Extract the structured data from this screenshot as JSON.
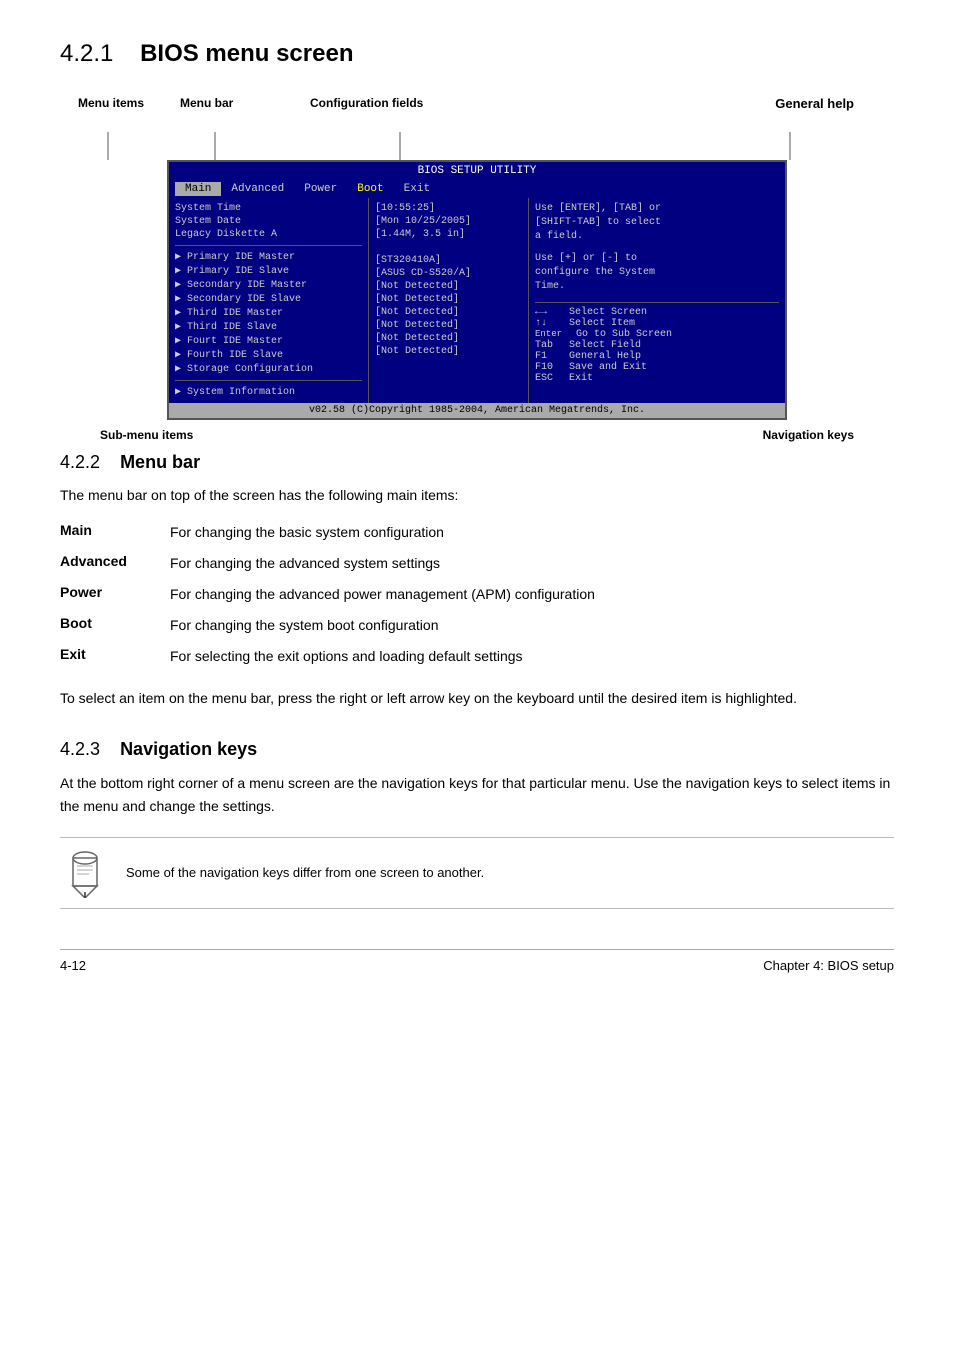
{
  "page": {
    "section_number": "4.2.1",
    "section_title": "BIOS menu screen",
    "subsections": [
      {
        "number": "4.2.2",
        "title": "Menu bar",
        "intro": "The menu bar on top of the screen has the following main items:",
        "menu_items": [
          {
            "key": "Main",
            "description": "For changing the basic system configuration"
          },
          {
            "key": "Advanced",
            "description": "For changing the advanced system settings"
          },
          {
            "key": "Power",
            "description": "For changing the advanced power management (APM) configuration"
          },
          {
            "key": "Boot",
            "description": "For changing the system boot configuration"
          },
          {
            "key": "Exit",
            "description": "For selecting the exit options and loading default settings"
          }
        ],
        "footer_text": "To select an item on the menu bar, press the right or left arrow key on the keyboard until the desired item is highlighted."
      },
      {
        "number": "4.2.3",
        "title": "Navigation keys",
        "intro": "At the bottom right corner of a menu screen are the navigation keys for that particular menu. Use the navigation keys to select items in the menu and change the settings.",
        "note": "Some of the navigation keys differ from one screen to another."
      }
    ]
  },
  "diagram": {
    "labels": {
      "menu_items": "Menu items",
      "menu_bar": "Menu bar",
      "config_fields": "Configuration fields",
      "general_help": "General help",
      "sub_menu_items": "Sub-menu items",
      "navigation_keys": "Navigation keys"
    },
    "bios": {
      "title": "BIOS SETUP UTILITY",
      "menu_bar": [
        "Main",
        "Advanced",
        "Power",
        "Boot",
        "Exit"
      ],
      "active_item": "Main",
      "left_panel": {
        "system_items": [
          {
            "label": "System Time",
            "type": "plain"
          },
          {
            "label": "System Date",
            "type": "plain"
          },
          {
            "label": "Legacy Diskette A",
            "type": "plain"
          }
        ],
        "submenu_items": [
          "Primary IDE Master",
          "Primary IDE Slave",
          "Secondary IDE Master",
          "Secondary IDE Slave",
          "Third IDE Master",
          "Third IDE Slave",
          "Fourt IDE Master",
          "Fourth IDE Slave",
          "Storage Configuration"
        ],
        "bottom_items": [
          "System Information"
        ]
      },
      "center_panel": {
        "values": [
          "[10:55:25]",
          "[Mon 10/25/2005]",
          "[1.44M, 3.5 in]",
          "",
          "[ST320410A]",
          "[ASUS CD-S520/A]",
          "[Not Detected]",
          "[Not Detected]",
          "[Not Detected]",
          "[Not Detected]",
          "[Not Detected]",
          "[Not Detected]"
        ]
      },
      "right_panel": {
        "help_text1": "Use [ENTER], [TAB] or [SHIFT-TAB] to select a field.",
        "help_text2": "Use [+] or [-] to configure the System Time.",
        "nav_keys": [
          {
            "key": "←→",
            "desc": "Select Screen"
          },
          {
            "key": "↑↓",
            "desc": "Select Item"
          },
          {
            "key": "Enter",
            "desc": "Go to Sub Screen"
          },
          {
            "key": "Tab",
            "desc": "Select Field"
          },
          {
            "key": "F1",
            "desc": "General Help"
          },
          {
            "key": "F10",
            "desc": "Save and Exit"
          },
          {
            "key": "ESC",
            "desc": "Exit"
          }
        ]
      },
      "footer": "v02.58 (C)Copyright 1985-2004, American Megatrends, Inc."
    }
  },
  "footer": {
    "page_number": "4-12",
    "chapter": "Chapter 4: BIOS setup"
  }
}
